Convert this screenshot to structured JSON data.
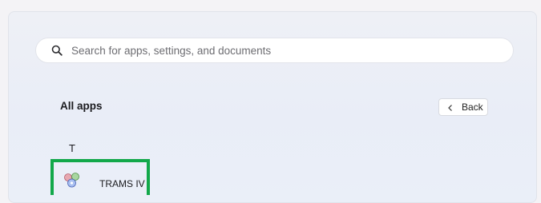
{
  "search": {
    "placeholder": "Search for apps, settings, and documents",
    "icon": "search-icon"
  },
  "all_apps": {
    "title": "All apps",
    "back_label": "Back",
    "back_icon": "chevron-left-icon"
  },
  "sections": [
    {
      "letter": "T",
      "apps": [
        {
          "label": "TRAMS IV",
          "icon": "trams-app-icon"
        }
      ]
    }
  ],
  "colors": {
    "highlight": "#12a84a"
  }
}
